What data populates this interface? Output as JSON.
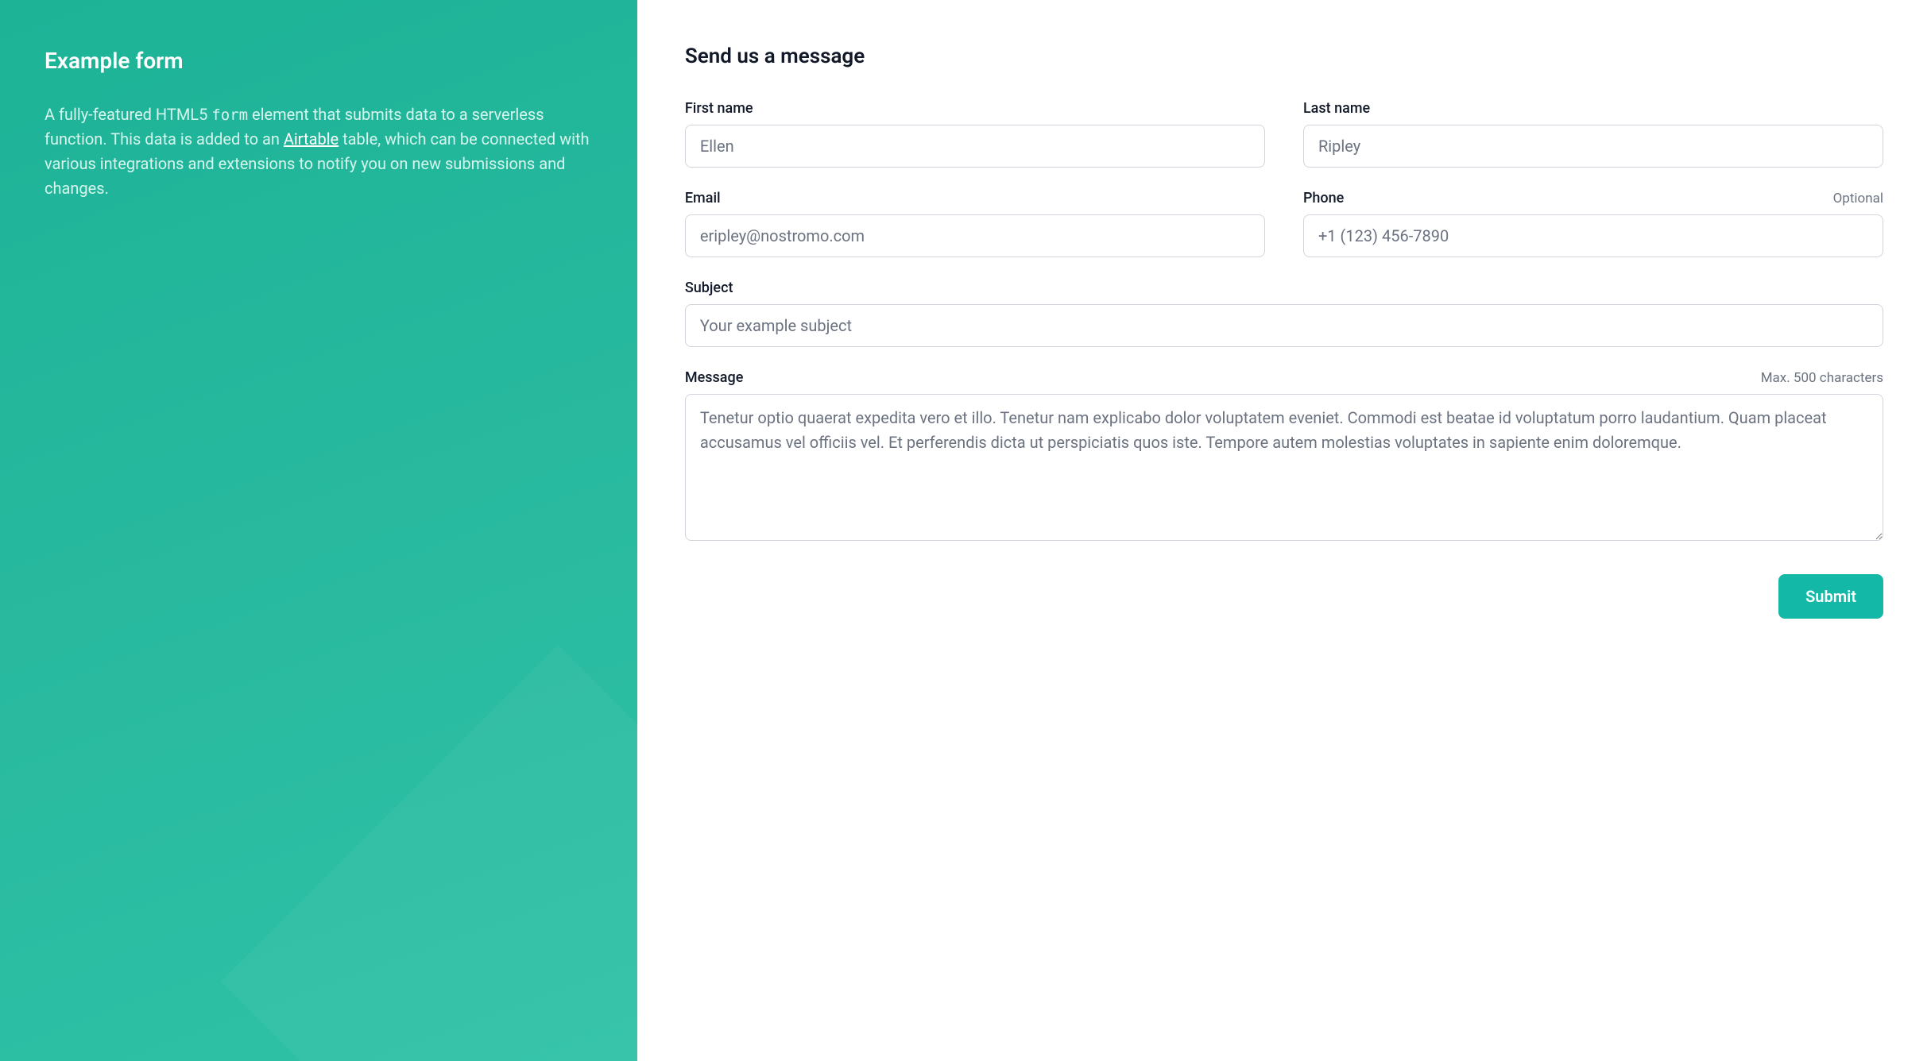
{
  "sidebar": {
    "title": "Example form",
    "desc_prefix": "A fully-featured HTML5 ",
    "desc_code": "form",
    "desc_mid": " element that submits data to a serverless function. This data is added to an ",
    "link_text": "Airtable",
    "desc_suffix": " table, which can be connected with various integrations and extensions to notify you on new submissions and changes."
  },
  "form": {
    "title": "Send us a message",
    "firstName": {
      "label": "First name",
      "placeholder": "Ellen"
    },
    "lastName": {
      "label": "Last name",
      "placeholder": "Ripley"
    },
    "email": {
      "label": "Email",
      "placeholder": "eripley@nostromo.com"
    },
    "phone": {
      "label": "Phone",
      "hint": "Optional",
      "placeholder": "+1 (123) 456-7890"
    },
    "subject": {
      "label": "Subject",
      "placeholder": "Your example subject"
    },
    "message": {
      "label": "Message",
      "hint": "Max. 500 characters",
      "placeholder": "Tenetur optio quaerat expedita vero et illo. Tenetur nam explicabo dolor voluptatem eveniet. Commodi est beatae id voluptatum porro laudantium. Quam placeat accusamus vel officiis vel. Et perferendis dicta ut perspiciatis quos iste. Tempore autem molestias voluptates in sapiente enim doloremque."
    },
    "submit": "Submit"
  }
}
